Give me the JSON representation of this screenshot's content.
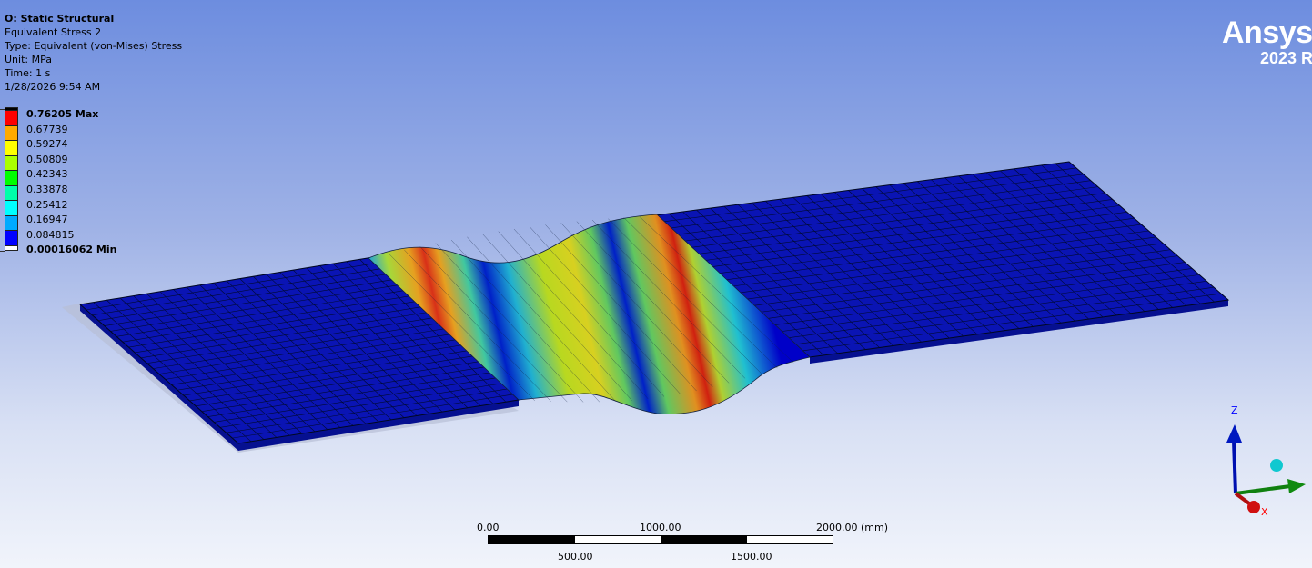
{
  "info": {
    "title": "O: Static Structural",
    "result": "Equivalent Stress 2",
    "type": "Type: Equivalent (von-Mises) Stress",
    "unit": "Unit: MPa",
    "time": "Time: 1 s",
    "date": "1/28/2026 9:54 AM"
  },
  "legend": {
    "max": "0.76205 Max",
    "min": "0.00016062 Min",
    "values": [
      "0.67739",
      "0.59274",
      "0.50809",
      "0.42343",
      "0.33878",
      "0.25412",
      "0.16947",
      "0.084815"
    ],
    "colors": [
      "#ff0000",
      "#ffaa00",
      "#ffff00",
      "#aaff00",
      "#00ff00",
      "#00ffaa",
      "#00ffff",
      "#00aaff",
      "#0000ff"
    ]
  },
  "logo": {
    "name": "Ansys",
    "version": "2023 R"
  },
  "scale_bar": {
    "top_labels": [
      "0.00",
      "1000.00",
      "2000.00 (mm)"
    ],
    "bottom_labels": [
      "500.00",
      "1500.00"
    ]
  },
  "triad": {
    "z_label": "Z",
    "x_label": "X"
  }
}
